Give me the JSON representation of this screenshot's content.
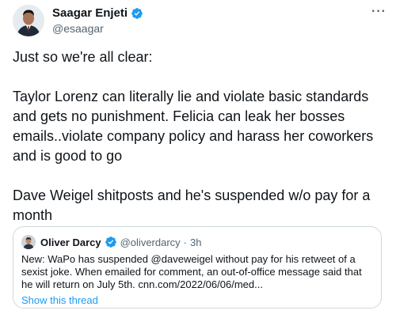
{
  "author": {
    "display_name": "Saagar Enjeti",
    "handle": "@esaagar",
    "verified_icon": "verified-badge-icon"
  },
  "more_label": "···",
  "tweet": {
    "paragraphs": [
      "Just so we're all clear:",
      "Taylor Lorenz can literally lie and violate basic standards and gets no punishment. Felicia can leak her bosses emails..violate company policy and harass her coworkers and is good to go",
      "Dave Weigel shitposts and he's suspended w/o pay for a month"
    ]
  },
  "quoted_tweet": {
    "display_name": "Oliver Darcy",
    "handle": "@oliverdarcy",
    "separator": "·",
    "time": "3h",
    "text": "New: WaPo has suspended @daveweigel without pay for his retweet of a sexist joke. When emailed for comment, an out-of-office message said that he will return on July 5th. cnn.com/2022/06/06/med...",
    "show_thread": "Show this thread"
  },
  "colors": {
    "verified_blue": "#1d9bf0",
    "link_blue": "#1d9bf0",
    "secondary_text": "#536471",
    "border": "#cfd9de"
  }
}
